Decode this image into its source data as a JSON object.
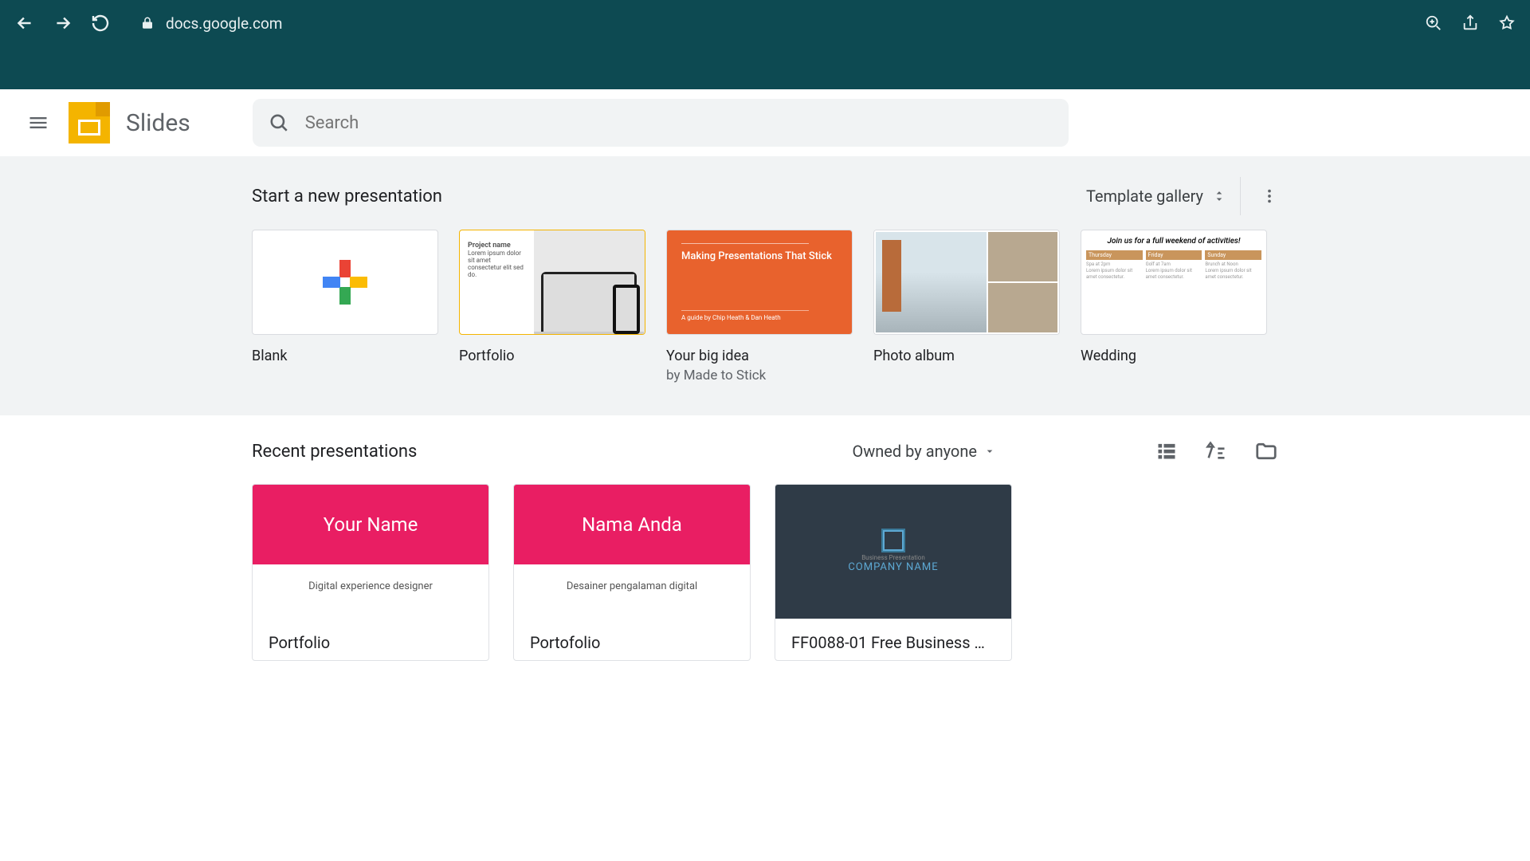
{
  "browser": {
    "url": "docs.google.com"
  },
  "app": {
    "title": "Slides",
    "search_placeholder": "Search"
  },
  "templates": {
    "heading": "Start a new presentation",
    "gallery_label": "Template gallery",
    "items": [
      {
        "label": "Blank",
        "sub": ""
      },
      {
        "label": "Portfolio",
        "sub": ""
      },
      {
        "label": "Your big idea",
        "sub": "by Made to Stick"
      },
      {
        "label": "Photo album",
        "sub": ""
      },
      {
        "label": "Wedding",
        "sub": ""
      }
    ],
    "portfolio_thumb_title": "Project name",
    "idea_thumb": {
      "title": "Making Presentations That Stick",
      "byline": "A guide by Chip Heath & Dan Heath"
    },
    "wedding_thumb": {
      "title": "Join us for a full weekend of activities!",
      "cols": [
        "Thursday",
        "Friday",
        "Sunday"
      ]
    }
  },
  "recent": {
    "heading": "Recent presentations",
    "owner_filter": "Owned by anyone",
    "cards": [
      {
        "title": "Portfolio",
        "thumb_name": "Your Name",
        "thumb_role": "Digital experience designer"
      },
      {
        "title": "Portofolio",
        "thumb_name": "Nama Anda",
        "thumb_role": "Desainer pengalaman digital"
      },
      {
        "title": "FF0088-01 Free Business …",
        "thumb_small": "Business Presentation",
        "thumb_company": "COMPANY NAME"
      }
    ]
  }
}
